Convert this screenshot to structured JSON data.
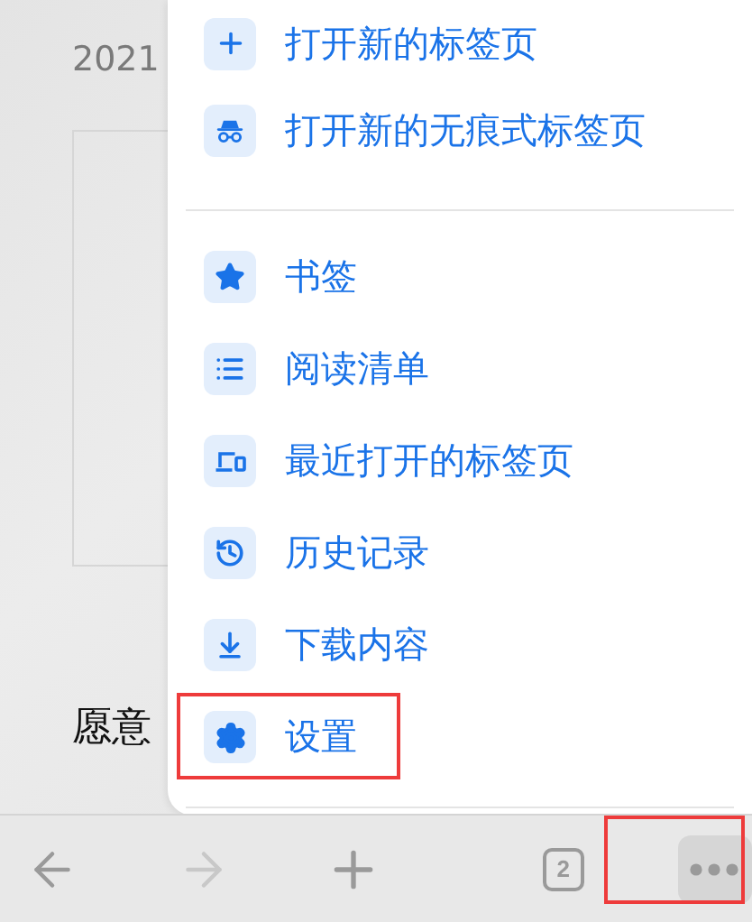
{
  "page": {
    "date": "2021",
    "paragraph_line": "愿意"
  },
  "menu": {
    "groups": [
      {
        "items": [
          {
            "label": "打开新的标签页",
            "highlighted": false
          },
          {
            "label": "打开新的无痕式标签页",
            "highlighted": false
          }
        ]
      },
      {
        "items": [
          {
            "label": "书签",
            "highlighted": false
          },
          {
            "label": "阅读清单",
            "highlighted": false
          },
          {
            "label": "最近打开的标签页",
            "highlighted": false
          },
          {
            "label": "历史记录",
            "highlighted": false
          },
          {
            "label": "下载内容",
            "highlighted": false
          },
          {
            "label": "设置",
            "highlighted": true
          }
        ]
      }
    ]
  },
  "toolbar": {
    "back": {
      "disabled": false
    },
    "forward": {
      "disabled": true
    },
    "tab_count": "2",
    "more": {
      "highlighted": true
    }
  }
}
